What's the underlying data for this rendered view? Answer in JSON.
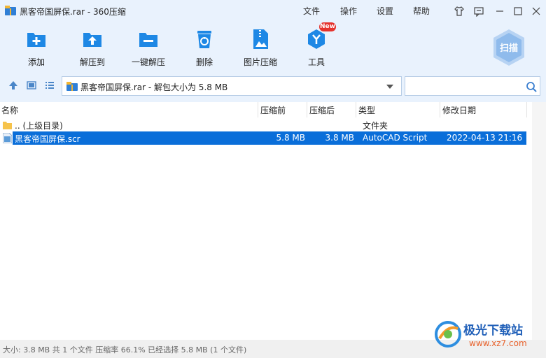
{
  "window": {
    "title": "黑客帝国屏保.rar - 360压缩"
  },
  "menu": {
    "items": [
      "文件",
      "操作",
      "设置",
      "帮助"
    ]
  },
  "titlebar_buttons": [
    "skin-icon",
    "feedback-icon",
    "minimize-icon",
    "maximize-icon",
    "close-icon"
  ],
  "toolbar": {
    "items": [
      {
        "label": "添加",
        "icon": "add-icon"
      },
      {
        "label": "解压到",
        "icon": "extract-to-icon"
      },
      {
        "label": "一键解压",
        "icon": "one-click-extract-icon"
      },
      {
        "label": "删除",
        "icon": "delete-icon"
      },
      {
        "label": "图片压缩",
        "icon": "image-compress-icon"
      },
      {
        "label": "工具",
        "icon": "tools-icon"
      }
    ],
    "new_badge": "New",
    "scan_label": "扫描"
  },
  "address": {
    "path": "黑客帝国屏保.rar - 解包大小为 5.8 MB",
    "search_placeholder": ""
  },
  "columns": {
    "name": "名称",
    "packed": "压缩前",
    "compressed": "压缩后",
    "type": "类型",
    "modified": "修改日期"
  },
  "rows": [
    {
      "name": ".. (上级目录)",
      "packed": "",
      "compressed": "",
      "type": "文件夹",
      "modified": "",
      "icon": "folder-icon",
      "selected": false
    },
    {
      "name": "黑客帝国屏保.scr",
      "packed": "5.8 MB",
      "compressed": "3.8 MB",
      "type": "AutoCAD Script",
      "modified": "2022-04-13 21:16",
      "icon": "file-icon",
      "selected": true
    }
  ],
  "status": {
    "text": "大小: 3.8 MB 共 1 个文件 压缩率 66.1% 已经选择 5.8 MB (1 个文件)"
  },
  "watermark": {
    "name": "极光下载站",
    "url": "www.xz7.com"
  },
  "colors": {
    "accent": "#1e88e5",
    "selection": "#0a6ed9",
    "chrome": "#e9f2fd"
  }
}
